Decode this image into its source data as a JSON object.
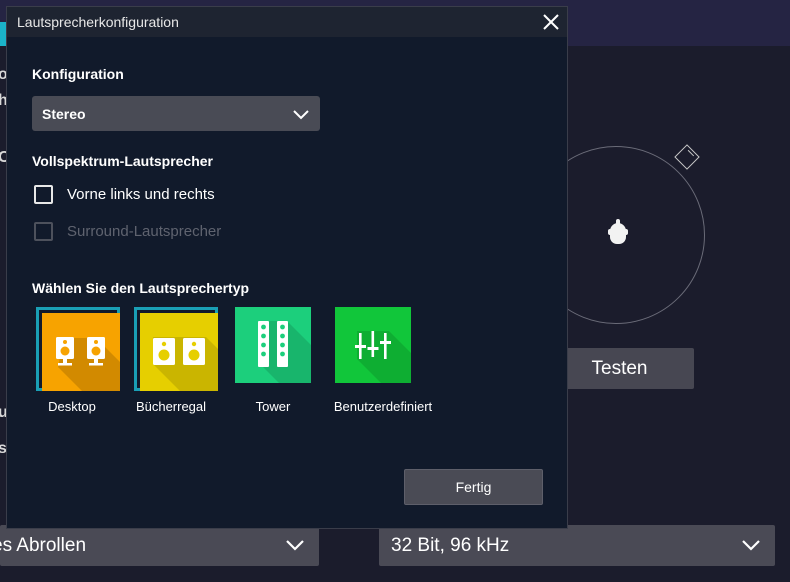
{
  "dialog": {
    "title": "Lautsprecherkonfiguration",
    "close_icon": "close-icon",
    "configuration": {
      "label": "Konfiguration",
      "selected": "Stereo"
    },
    "fullrange": {
      "label": "Vollspektrum-Lautsprecher",
      "front": {
        "label": "Vorne links und rechts",
        "checked": false
      },
      "surround": {
        "label": "Surround-Lautsprecher",
        "checked": false,
        "disabled": true
      }
    },
    "speaker_type": {
      "label": "Wählen Sie den Lautsprechertyp",
      "options": [
        {
          "label": "Desktop",
          "color": "#f7a300",
          "selected": true
        },
        {
          "label": "Bücherregal",
          "color": "#e6cf00",
          "selected": true
        },
        {
          "label": "Tower",
          "color": "#1ccf7c",
          "selected": false
        },
        {
          "label": "Benutzerdefiniert",
          "color": "#11c63a",
          "selected": false
        }
      ]
    },
    "done_label": "Fertig"
  },
  "background": {
    "test_button": "Testen",
    "left_select_value": "es Abrollen",
    "right_select_value": "32 Bit, 96 kHz",
    "clipped_letters": [
      "o",
      "h",
      "O",
      "u",
      "s"
    ]
  },
  "colors": {
    "dialog_bg": "#111a2b",
    "accent": "#1a9fb5",
    "page_bg": "#1b1c2c"
  }
}
